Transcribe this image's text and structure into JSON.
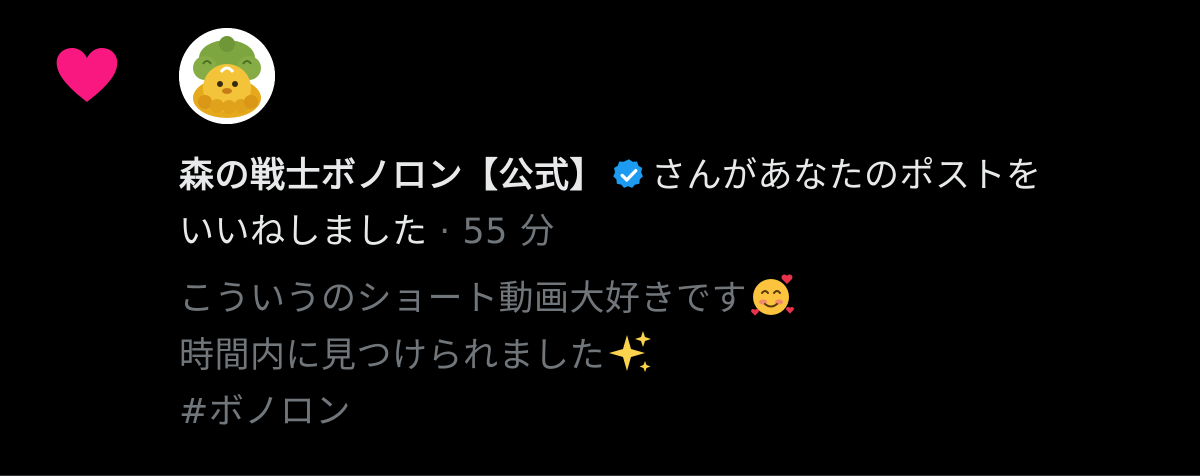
{
  "notification": {
    "user_name": "森の戦士ボノロン【公式】",
    "action_text_line1": "さんがあなたのポストを",
    "action_text_line2": "いいねしました",
    "separator": " · ",
    "time_ago": "55 分",
    "icons": {
      "like": "heart-icon",
      "verified": "verified-badge-icon",
      "avatar": "bonolon-avatar"
    },
    "colors": {
      "like": "#f91880",
      "verified": "#1d9bf0",
      "primary_text": "#e7e9ea",
      "secondary_text": "#71767b",
      "background": "#000000"
    }
  },
  "tweet": {
    "line1": "こういうのショート動画大好きです",
    "line1_emoji": "smiling-face-with-hearts",
    "line2": "時間内に見つけられました",
    "line2_emoji": "sparkles",
    "line3": "#ボノロン"
  }
}
